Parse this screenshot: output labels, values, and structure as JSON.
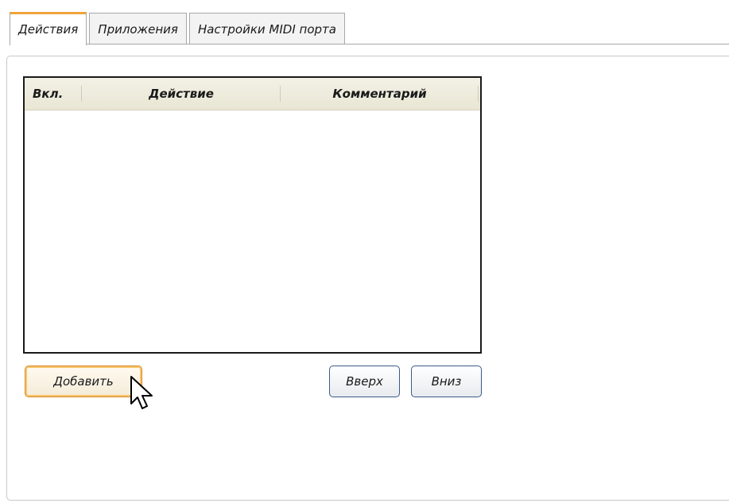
{
  "tabs": [
    {
      "label": "Действия",
      "active": true
    },
    {
      "label": "Приложения",
      "active": false
    },
    {
      "label": "Настройки MIDI порта",
      "active": false
    }
  ],
  "table": {
    "columns": [
      "Вкл.",
      "Действие",
      "Комментарий"
    ],
    "rows": []
  },
  "buttons": {
    "add": "Добавить",
    "up": "Вверх",
    "down": "Вниз"
  },
  "colors": {
    "active_tab_accent": "#f0a33c",
    "focused_button_border": "#d88a2a",
    "button_border": "#3c5a86",
    "header_bg": "#efede0"
  },
  "icons": {
    "cursor": "mouse-pointer-icon"
  }
}
